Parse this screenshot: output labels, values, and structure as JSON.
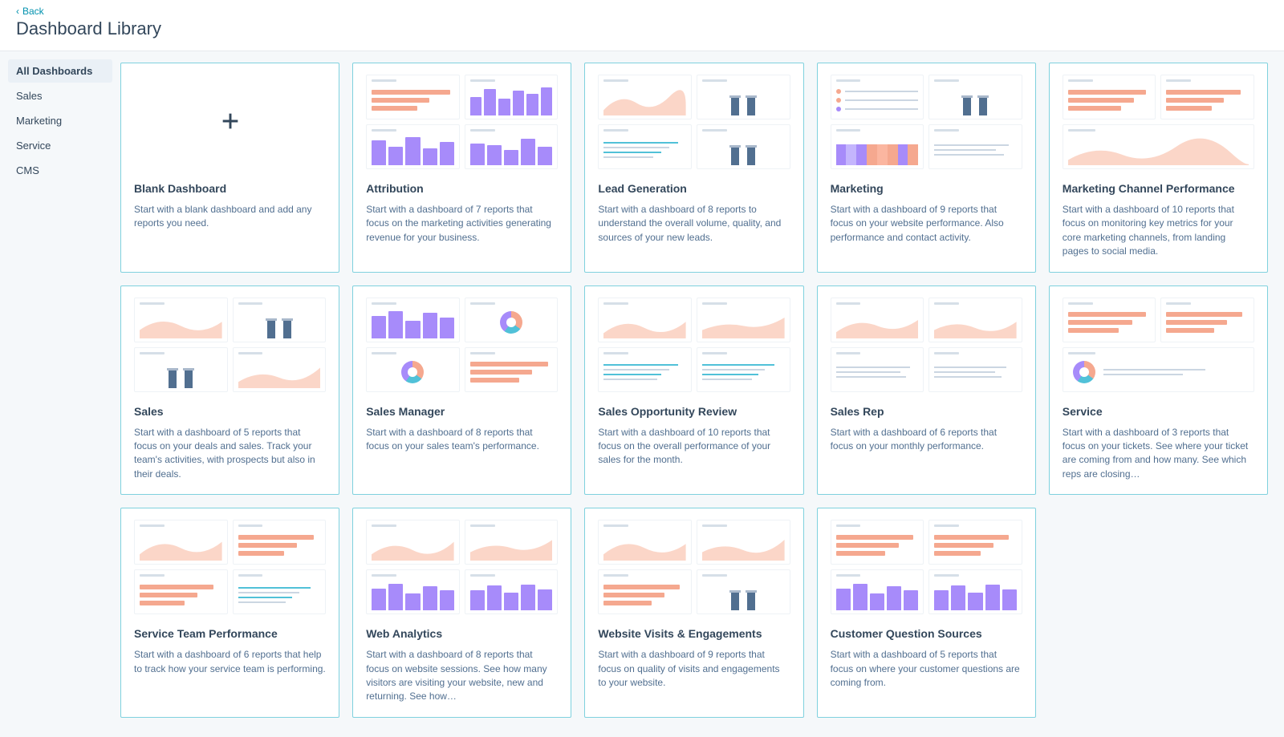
{
  "header": {
    "back_label": "Back",
    "page_title": "Dashboard Library"
  },
  "sidebar": {
    "items": [
      {
        "label": "All Dashboards",
        "active": true
      },
      {
        "label": "Sales",
        "active": false
      },
      {
        "label": "Marketing",
        "active": false
      },
      {
        "label": "Service",
        "active": false
      },
      {
        "label": "CMS",
        "active": false
      }
    ]
  },
  "cards": [
    {
      "id": "blank",
      "title": "Blank Dashboard",
      "desc": "Start with a blank dashboard and add any reports you need.",
      "thumb": "blank"
    },
    {
      "id": "attribution",
      "title": "Attribution",
      "desc": "Start with a dashboard of 7 reports that focus on the marketing activities generating revenue for your business.",
      "thumb": "t_attr"
    },
    {
      "id": "lead-generation",
      "title": "Lead Generation",
      "desc": "Start with a dashboard of 8 reports to understand the overall volume, quality, and sources of your new leads.",
      "thumb": "t_lead"
    },
    {
      "id": "marketing",
      "title": "Marketing",
      "desc": "Start with a dashboard of 9 reports that focus on your website performance. Also performance and contact activity.",
      "thumb": "t_mkt"
    },
    {
      "id": "marketing-channel-performance",
      "title": "Marketing Channel Performance",
      "desc": "Start with a dashboard of 10 reports that focus on monitoring key metrics for your core marketing channels, from landing pages to social media.",
      "thumb": "t_mcp"
    },
    {
      "id": "sales",
      "title": "Sales",
      "desc": "Start with a dashboard of 5 reports that focus on your deals and sales. Track your team's activities, with prospects but also in their deals.",
      "thumb": "t_sales"
    },
    {
      "id": "sales-manager",
      "title": "Sales Manager",
      "desc": "Start with a dashboard of 8 reports that focus on your sales team's performance.",
      "thumb": "t_smgr"
    },
    {
      "id": "sales-opportunity-review",
      "title": "Sales Opportunity Review",
      "desc": "Start with a dashboard of 10 reports that focus on the overall performance of your sales for the month.",
      "thumb": "t_sor"
    },
    {
      "id": "sales-rep",
      "title": "Sales Rep",
      "desc": "Start with a dashboard of 6 reports that focus on your monthly performance.",
      "thumb": "t_srep"
    },
    {
      "id": "service",
      "title": "Service",
      "desc": "Start with a dashboard of 3 reports that focus on your tickets. See where your ticket are coming from and how many. See which reps are closing…",
      "thumb": "t_svc"
    },
    {
      "id": "service-team-performance",
      "title": "Service Team Performance",
      "desc": "Start with a dashboard of 6 reports that help to track how your service team is performing.",
      "thumb": "t_stp"
    },
    {
      "id": "web-analytics",
      "title": "Web Analytics",
      "desc": "Start with a dashboard of 8 reports that focus on website sessions. See how many visitors are visiting your website, new and returning. See how…",
      "thumb": "t_web"
    },
    {
      "id": "website-visits-engagements",
      "title": "Website Visits & Engagements",
      "desc": "Start with a dashboard of 9 reports that focus on quality of visits and engagements to your website.",
      "thumb": "t_wve"
    },
    {
      "id": "customer-question-sources",
      "title": "Customer Question Sources",
      "desc": "Start with a dashboard of 5 reports that focus on where your customer questions are coming from.",
      "thumb": "t_cqs"
    }
  ]
}
